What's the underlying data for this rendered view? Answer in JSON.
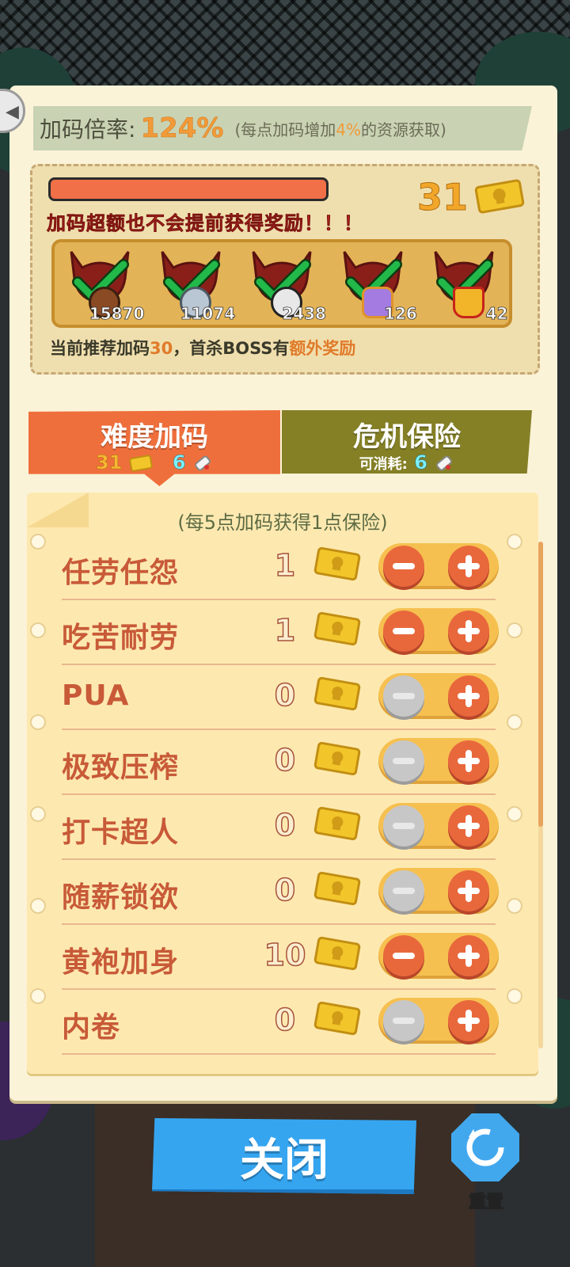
{
  "rate": {
    "label": "加码倍率:",
    "value": "124%",
    "note_prefix": "(每点加码增加",
    "note_percent": "4%",
    "note_suffix": "的资源获取)"
  },
  "reward": {
    "progress_fraction": 1.0,
    "warning": "加码超额也不会提前获得奖励！！！",
    "ticket_count": "31",
    "bosses": [
      {
        "count": "15870",
        "item_icon": "coffee-cup-icon",
        "checked": true
      },
      {
        "count": "11074",
        "item_icon": "screw-icon",
        "checked": true
      },
      {
        "count": "2438",
        "item_icon": "tape-icon",
        "checked": true
      },
      {
        "count": "126",
        "item_icon": "potion-jar-icon",
        "checked": true
      },
      {
        "count": "42",
        "item_icon": "crown-icon",
        "checked": true
      }
    ],
    "recommend_prefix": "当前推荐加码",
    "recommend_value": "30",
    "recommend_mid": "，首杀BOSS有",
    "recommend_hl": "额外奖励"
  },
  "tabs": {
    "difficulty": {
      "label": "难度加码",
      "tickets": "31",
      "scrolls": "6"
    },
    "insurance": {
      "label": "危机保险",
      "consumable_label": "可消耗:",
      "scrolls": "6"
    }
  },
  "list": {
    "note": "(每5点加码获得1点保险)",
    "rows": [
      {
        "name": "任劳任怨",
        "cost": "1",
        "minus_enabled": true
      },
      {
        "name": "吃苦耐劳",
        "cost": "1",
        "minus_enabled": true
      },
      {
        "name": "PUA",
        "cost": "0",
        "minus_enabled": false
      },
      {
        "name": "极致压榨",
        "cost": "0",
        "minus_enabled": false
      },
      {
        "name": "打卡超人",
        "cost": "0",
        "minus_enabled": false
      },
      {
        "name": "随薪锁欲",
        "cost": "0",
        "minus_enabled": false
      },
      {
        "name": "黄袍加身",
        "cost": "10",
        "minus_enabled": true
      },
      {
        "name": "内卷",
        "cost": "0",
        "minus_enabled": false
      }
    ]
  },
  "bottom": {
    "close_label": "关闭",
    "reset_label": "重置"
  },
  "colors": {
    "accent_orange": "#ef6f3c",
    "olive_tab": "#858026",
    "ticket_gold": "#f2c62b",
    "check_green": "#22b84a",
    "close_blue": "#35a5f0"
  }
}
